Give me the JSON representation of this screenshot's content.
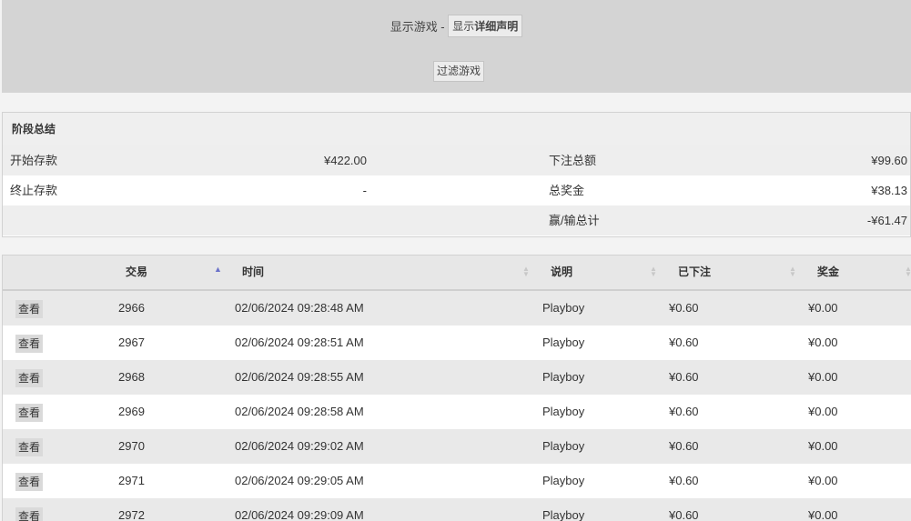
{
  "header": {
    "show_games_label": "显示游戏 -",
    "detail_button_prefix": "显示",
    "detail_button_bold": "详细声明",
    "filter_button_label": "过滤游戏"
  },
  "summary": {
    "title": "阶段总结",
    "rows": [
      {
        "label1": "开始存款",
        "value1": "¥422.00",
        "label2": "下注总额",
        "value2": "¥99.60"
      },
      {
        "label1": "终止存款",
        "value1": "-",
        "label2": "总奖金",
        "value2": "¥38.13"
      },
      {
        "label1": "",
        "value1": "",
        "label2": "赢/输总计",
        "value2": "-¥61.47"
      }
    ]
  },
  "table": {
    "columns": {
      "id": "交易",
      "time": "时间",
      "desc": "说明",
      "bet": "已下注",
      "win": "奖金"
    },
    "sort_active_icon": "sort-ascending-icon",
    "view_label": "查看",
    "rows": [
      {
        "id": "2966",
        "time": "02/06/2024 09:28:48 AM",
        "desc": "Playboy",
        "bet": "¥0.60",
        "win": "¥0.00"
      },
      {
        "id": "2967",
        "time": "02/06/2024 09:28:51 AM",
        "desc": "Playboy",
        "bet": "¥0.60",
        "win": "¥0.00"
      },
      {
        "id": "2968",
        "time": "02/06/2024 09:28:55 AM",
        "desc": "Playboy",
        "bet": "¥0.60",
        "win": "¥0.00"
      },
      {
        "id": "2969",
        "time": "02/06/2024 09:28:58 AM",
        "desc": "Playboy",
        "bet": "¥0.60",
        "win": "¥0.00"
      },
      {
        "id": "2970",
        "time": "02/06/2024 09:29:02 AM",
        "desc": "Playboy",
        "bet": "¥0.60",
        "win": "¥0.00"
      },
      {
        "id": "2971",
        "time": "02/06/2024 09:29:05 AM",
        "desc": "Playboy",
        "bet": "¥0.60",
        "win": "¥0.00"
      },
      {
        "id": "2972",
        "time": "02/06/2024 09:29:09 AM",
        "desc": "Playboy",
        "bet": "¥0.60",
        "win": "¥0.00"
      }
    ]
  }
}
